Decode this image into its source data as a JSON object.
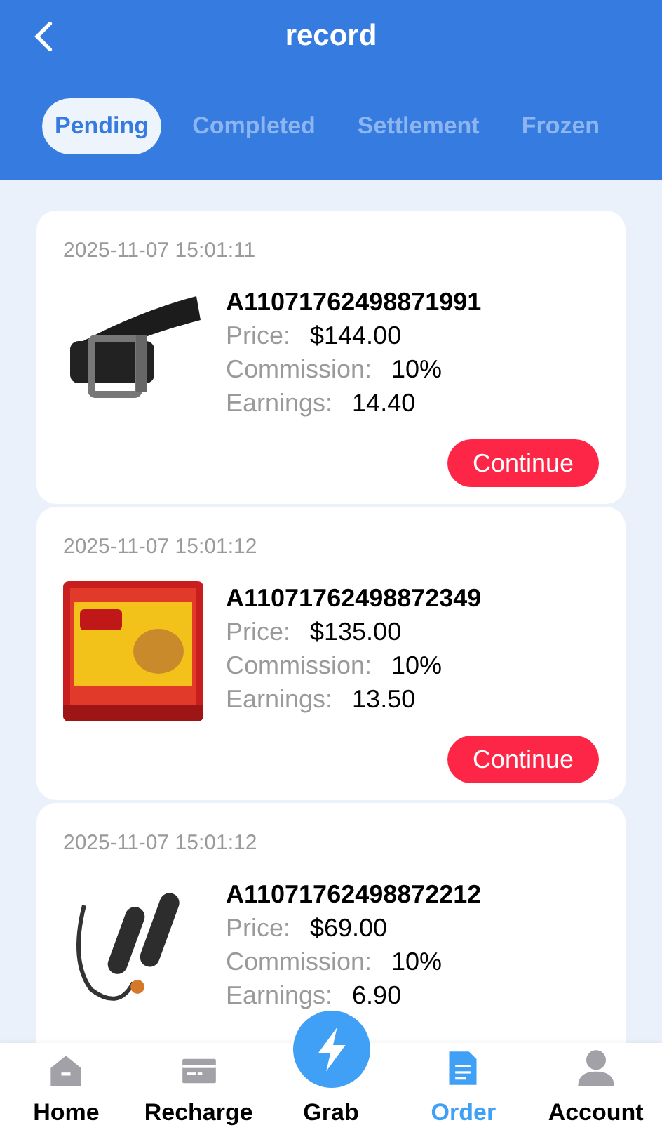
{
  "header": {
    "title": "record"
  },
  "tabs": [
    {
      "label": "Pending",
      "selected": true
    },
    {
      "label": "Completed",
      "selected": false
    },
    {
      "label": "Settlement",
      "selected": false
    },
    {
      "label": "Frozen",
      "selected": false
    }
  ],
  "orders": [
    {
      "time": "2025-11-07 15:01:11",
      "order_no": "A11071762498871991",
      "price_label": "Price:",
      "price": "$144.00",
      "commission_label": "Commission:",
      "commission": "10%",
      "earnings_label": "Earnings:",
      "earnings": "14.40",
      "button": "Continue"
    },
    {
      "time": "2025-11-07 15:01:12",
      "order_no": "A11071762498872349",
      "price_label": "Price:",
      "price": "$135.00",
      "commission_label": "Commission:",
      "commission": "10%",
      "earnings_label": "Earnings:",
      "earnings": "13.50",
      "button": "Continue"
    },
    {
      "time": "2025-11-07 15:01:12",
      "order_no": "A11071762498872212",
      "price_label": "Price:",
      "price": "$69.00",
      "commission_label": "Commission:",
      "commission": "10%",
      "earnings_label": "Earnings:",
      "earnings": "6.90"
    }
  ],
  "nav": [
    {
      "kind": "home",
      "label": "Home",
      "selected": false
    },
    {
      "kind": "recharge",
      "label": "Recharge",
      "selected": false
    },
    {
      "kind": "grab",
      "label": "Grab",
      "selected": false
    },
    {
      "kind": "order",
      "label": "Order",
      "selected": true
    },
    {
      "kind": "account",
      "label": "Account",
      "selected": false
    }
  ]
}
